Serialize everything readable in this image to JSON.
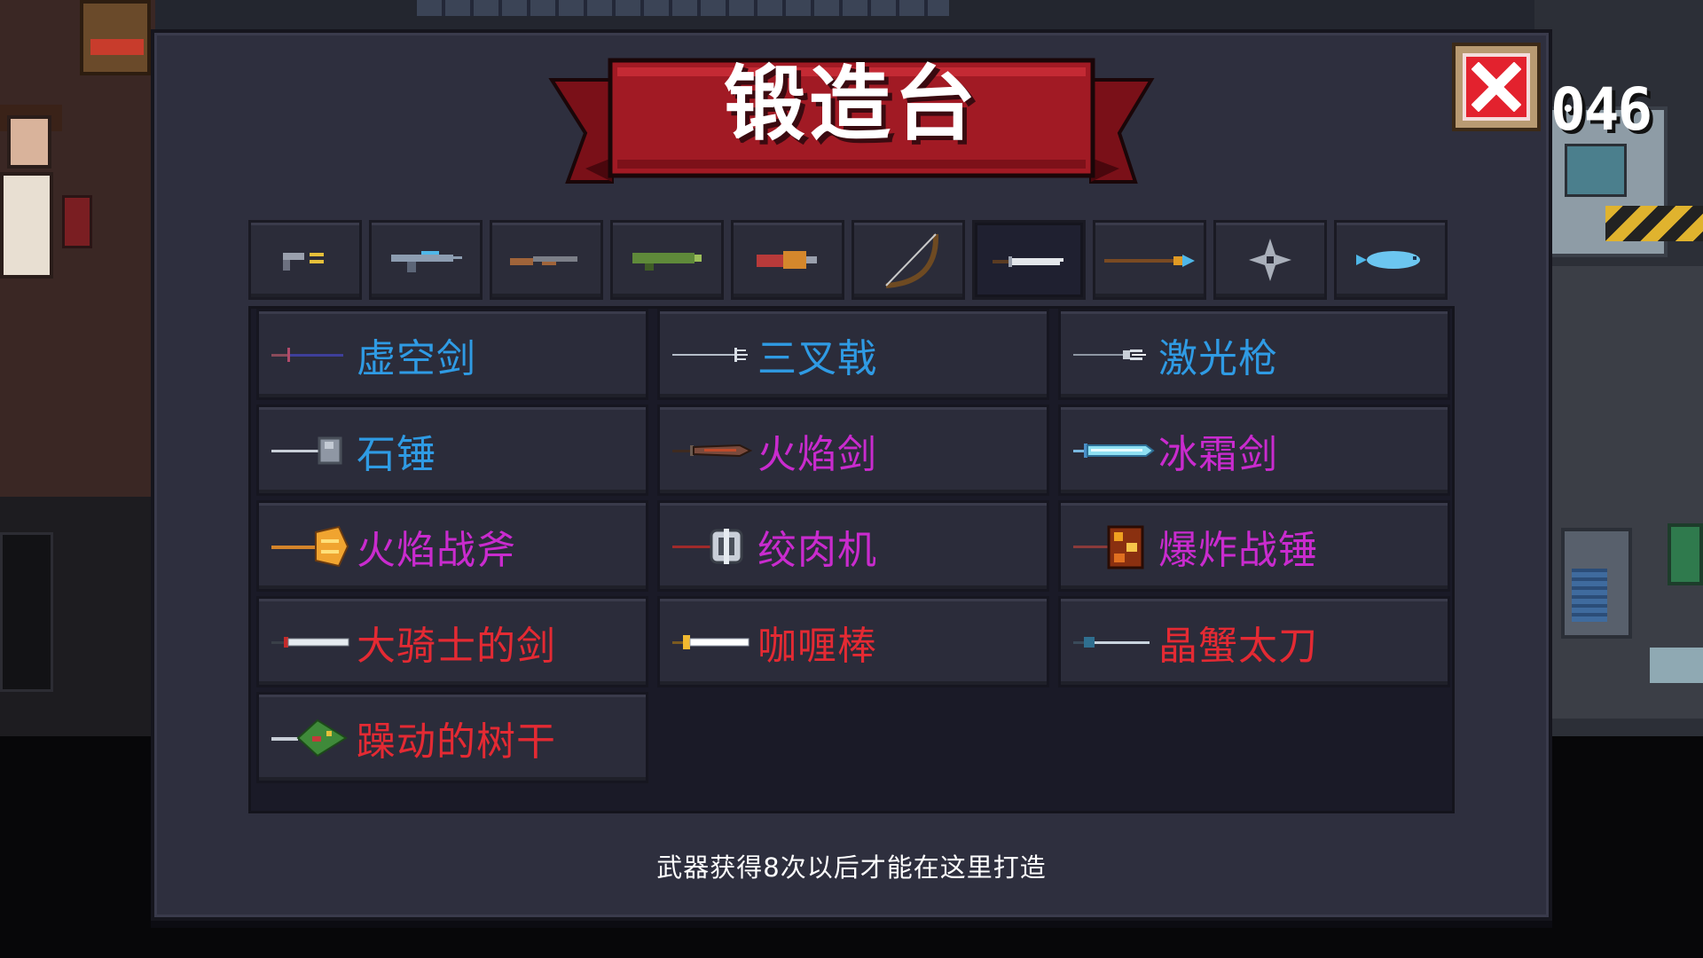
{
  "hud": {
    "counter": "046"
  },
  "panel": {
    "title": "锻造台",
    "close_icon": "close-x-icon",
    "footer_note": "武器获得8次以后才能在这里打造"
  },
  "tabs": [
    {
      "icon": "pistol-icon",
      "active": false
    },
    {
      "icon": "rifle-icon",
      "active": false
    },
    {
      "icon": "shotgun-icon",
      "active": false
    },
    {
      "icon": "launcher-icon",
      "active": false
    },
    {
      "icon": "heavy-gun-icon",
      "active": false
    },
    {
      "icon": "bow-icon",
      "active": false
    },
    {
      "icon": "sword-icon",
      "active": true
    },
    {
      "icon": "spear-icon",
      "active": false
    },
    {
      "icon": "shuriken-icon",
      "active": false
    },
    {
      "icon": "fish-icon",
      "active": false
    }
  ],
  "weapons": [
    {
      "name": "虚空剑",
      "rarity_color": "#2f9be4",
      "icon": "void-sword-icon"
    },
    {
      "name": "三叉戟",
      "rarity_color": "#2f9be4",
      "icon": "trident-icon"
    },
    {
      "name": "激光枪",
      "rarity_color": "#2f9be4",
      "icon": "laser-spear-icon"
    },
    {
      "name": "石锤",
      "rarity_color": "#2f9be4",
      "icon": "stone-hammer-icon"
    },
    {
      "name": "火焰剑",
      "rarity_color": "#c92bce",
      "icon": "flame-sword-icon"
    },
    {
      "name": "冰霜剑",
      "rarity_color": "#c92bce",
      "icon": "frost-sword-icon"
    },
    {
      "name": "火焰战斧",
      "rarity_color": "#c92bce",
      "icon": "flame-axe-icon"
    },
    {
      "name": "绞肉机",
      "rarity_color": "#c92bce",
      "icon": "meat-grinder-icon"
    },
    {
      "name": "爆炸战锤",
      "rarity_color": "#c92bce",
      "icon": "explosive-hammer-icon"
    },
    {
      "name": "大骑士的剑",
      "rarity_color": "#e42a33",
      "icon": "knight-sword-icon"
    },
    {
      "name": "咖喱棒",
      "rarity_color": "#e42a33",
      "icon": "excalibur-icon"
    },
    {
      "name": "晶蟹太刀",
      "rarity_color": "#e42a33",
      "icon": "crystal-katana-icon"
    },
    {
      "name": "躁动的树干",
      "rarity_color": "#e42a33",
      "icon": "tree-trunk-icon"
    }
  ]
}
